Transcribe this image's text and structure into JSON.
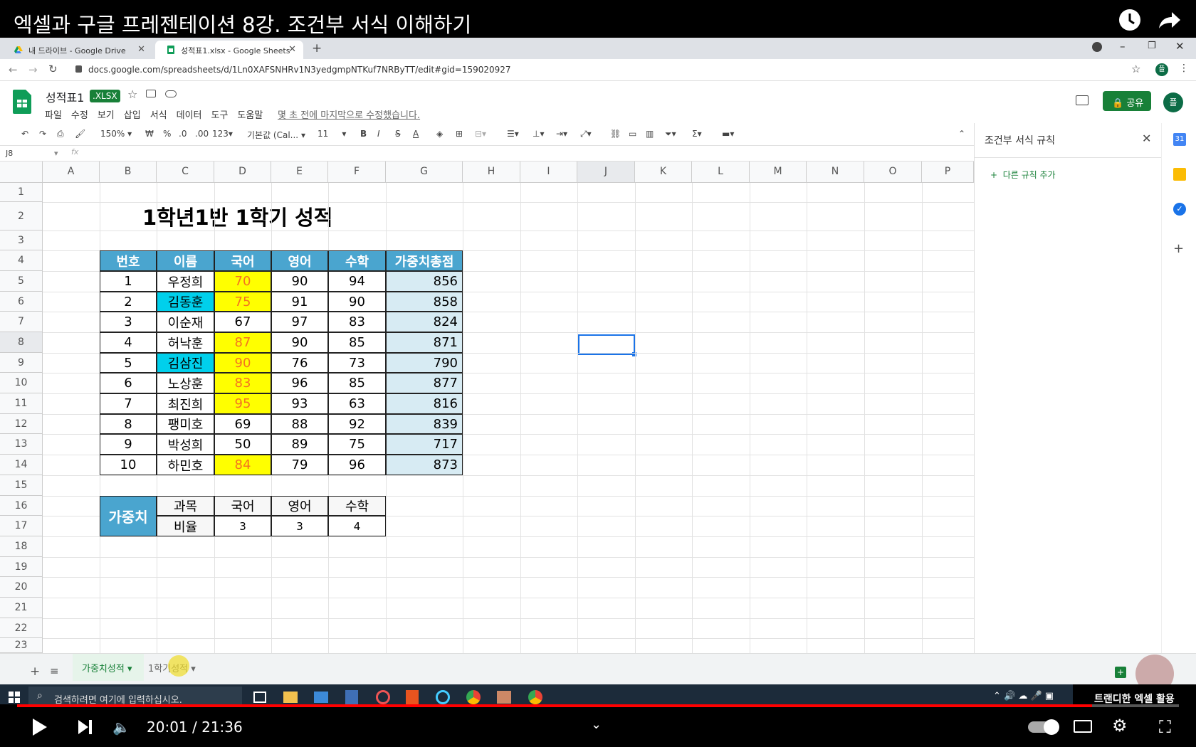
{
  "video": {
    "title": "엑셀과 구글 프레젠테이션 8강. 조건부 서식 이해하기",
    "time": "20:01 / 21:36",
    "progress_fraction": 0.925,
    "channel_watermark": "트랜디한 엑셀 활용"
  },
  "browser": {
    "tabs": [
      {
        "label": "내 드라이브 - Google Drive"
      },
      {
        "label": "성적표1.xlsx - Google Sheets"
      }
    ],
    "url": "docs.google.com/spreadsheets/d/1Ln0XAFSNHRv1N3yedgmpNTKuf7NRByTT/edit#gid=159020927",
    "profile_initial": "플"
  },
  "sheets": {
    "doc_name": "성적표1",
    "badge": ".XLSX",
    "menu": [
      "파일",
      "수정",
      "보기",
      "삽입",
      "서식",
      "데이터",
      "도구",
      "도움말"
    ],
    "last_edit": "몇 초 전에 마지막으로 수정했습니다.",
    "share_label": "공유",
    "avatar_initial": "플",
    "toolbar": {
      "zoom": "150%",
      "currency": "₩",
      "percent": "%",
      "dec_less": ".0",
      "dec_more": ".00",
      "format_more": "123",
      "font": "기본값 (Cal...",
      "font_size": "11"
    },
    "name_box": "J8",
    "fx": "fx",
    "columns": [
      "A",
      "B",
      "C",
      "D",
      "E",
      "F",
      "G",
      "H",
      "I",
      "J",
      "K",
      "L",
      "M",
      "N",
      "O",
      "P"
    ],
    "rows": [
      "1",
      "2",
      "3",
      "4",
      "5",
      "6",
      "7",
      "8",
      "9",
      "10",
      "11",
      "12",
      "13",
      "14",
      "15",
      "16",
      "17",
      "18",
      "19",
      "20",
      "21",
      "22",
      "23"
    ],
    "title": "1학년1반 1학기 성적",
    "table_headers": [
      "번호",
      "이름",
      "국어",
      "영어",
      "수학",
      "가중치총점"
    ],
    "table_rows": [
      [
        "1",
        "우정희",
        "70",
        "90",
        "94",
        "856"
      ],
      [
        "2",
        "김동훈",
        "75",
        "91",
        "90",
        "858"
      ],
      [
        "3",
        "이순재",
        "67",
        "97",
        "83",
        "824"
      ],
      [
        "4",
        "허낙훈",
        "87",
        "90",
        "85",
        "871"
      ],
      [
        "5",
        "김삼진",
        "90",
        "76",
        "73",
        "790"
      ],
      [
        "6",
        "노상훈",
        "83",
        "96",
        "85",
        "877"
      ],
      [
        "7",
        "최진희",
        "95",
        "93",
        "63",
        "816"
      ],
      [
        "8",
        "팽미호",
        "69",
        "88",
        "92",
        "839"
      ],
      [
        "9",
        "박성희",
        "50",
        "89",
        "75",
        "717"
      ],
      [
        "10",
        "하민호",
        "84",
        "79",
        "96",
        "873"
      ]
    ],
    "weights": {
      "label": "가중치",
      "subject_label": "과목",
      "ratio_label": "비율",
      "subjects": [
        "국어",
        "영어",
        "수학"
      ],
      "ratios": [
        "3",
        "3",
        "4"
      ]
    },
    "cf_panel": {
      "title": "조건부 서식 규칙",
      "add_rule": "다른 규칙 추가"
    },
    "sheet_tabs": [
      "가중치성적",
      "1학기성적"
    ]
  },
  "taskbar": {
    "search_placeholder": "검색하려면 여기에 입력하십시오."
  },
  "colors": {
    "header_blue": "#4aa5cf",
    "highlight_yellow": "#ffff00",
    "highlight_cyan": "#00d0ec",
    "total_bg": "#d7ebf3",
    "brand_green": "#188038"
  }
}
